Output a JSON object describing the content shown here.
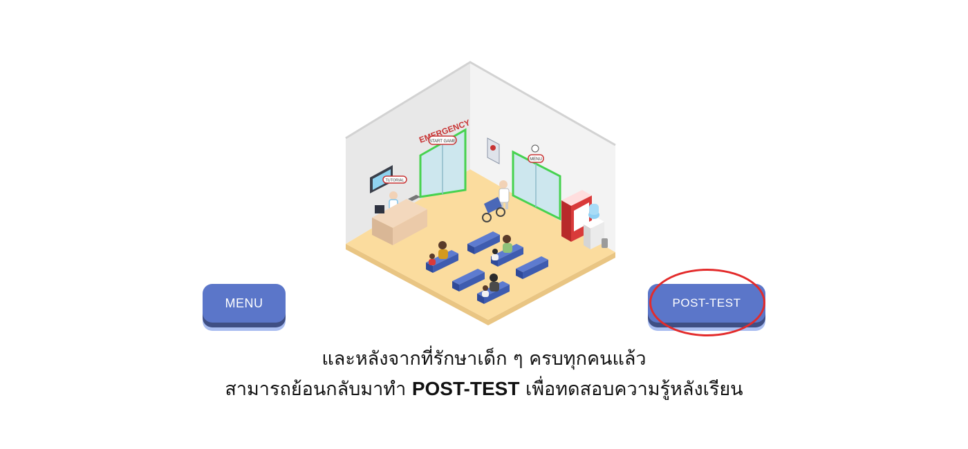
{
  "scene": {
    "emergency_sign": "EMERGENCY",
    "start_game_tag": "START GAME",
    "tutorial_tag": "TUTORIAL",
    "menu_tag": "MENU",
    "colors": {
      "floor": "#fbdc9e",
      "wall": "#f0f0f0",
      "door_glow": "#46d24f",
      "bench": "#3e5cb0",
      "accent_red": "#c83434"
    }
  },
  "buttons": {
    "menu_label": "MENU",
    "posttest_label": "POST-TEST",
    "color": "#5b76c9",
    "highlight_color": "#e32b2b"
  },
  "caption": {
    "line1": "และหลังจากที่รักษาเด็ก ๆ ครบทุกคนแล้ว",
    "line2_before": "สามารถย้อนกลับมาทำ ",
    "line2_bold": "POST-TEST",
    "line2_after": " เพื่อทดสอบความรู้หลังเรียน"
  }
}
